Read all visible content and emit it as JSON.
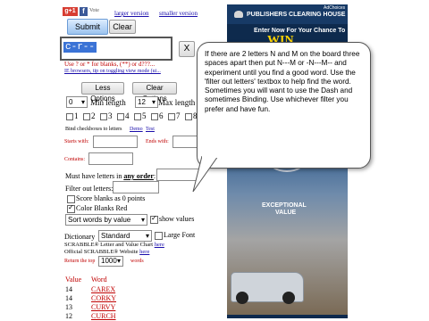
{
  "top": {
    "share_badge": "g+1",
    "fb_label": "f",
    "count_label": "Vote",
    "larger_version": "larger version",
    "smaller_version": "smaller version"
  },
  "form": {
    "submit_label": "Submit",
    "clear_label": "Clear",
    "query_value": "c-r--",
    "x_label": "X",
    "hint_line": "Use ? or * for blanks, (**) or d???...",
    "hint_links": "IE browsers, tip on toggling view mode (ui...",
    "less_options_label": "Less Options",
    "clear_options_label": "Clear Options",
    "min_length_value": "0",
    "min_length_label": "Min length",
    "max_length_value": "12",
    "max_length_label": "Max length",
    "positions": [
      "1",
      "2",
      "3",
      "4",
      "5",
      "6",
      "7",
      "8"
    ],
    "bind_label": "Bind checkboxes to letters",
    "demo_link": "Demo",
    "test_link": "Test",
    "starts_with_label": "Starts with:",
    "ends_with_label": "Ends with:",
    "contains_label": "Contains:",
    "must_have_label": "Must have letters in",
    "any_order_label": "any order",
    "filter_out_label": "Filter out letters:",
    "score_blanks_label": "Score blanks as 0 points",
    "color_blanks_label": "Color Blanks Red",
    "sort_label": "Sort words by value",
    "show_values_label": "show values",
    "dictionary_label": "Dictionary",
    "dictionary_value": "Standard",
    "large_font_label": "Large Font",
    "chart_line": "SCRABBLE® Letter and Value Chart",
    "chart_link": "here",
    "official_line": "Official SCRABBLE® Website",
    "official_link": "here",
    "return_label": "Return the top",
    "return_value": "1000",
    "words_label": "words"
  },
  "results": {
    "col_value": "Value",
    "col_word": "Word",
    "rows": [
      {
        "value": "14",
        "word": "CAREX"
      },
      {
        "value": "14",
        "word": "CORKY"
      },
      {
        "value": "13",
        "word": "CURVY"
      },
      {
        "value": "12",
        "word": "CURCH"
      }
    ]
  },
  "callout": {
    "text": "If there are 2 letters N and M on the board three spaces apart then put N---M or -N---M-- and experiment until you find a good word.  Use the 'filter out letters' textbox to help find the word.  Sometimes you will want to use the Dash and sometimes Binding. Use whichever filter you prefer and have fun."
  },
  "ad": {
    "brand": "PUBLISHERS CLEARING HOUSE",
    "corner_tag": "AdChoices",
    "enter_line": "Enter Now For Your Chance To",
    "win_word": "WIN",
    "exceptional_line1": "EXCEPTIONAL",
    "exceptional_line2": "VALUE"
  }
}
